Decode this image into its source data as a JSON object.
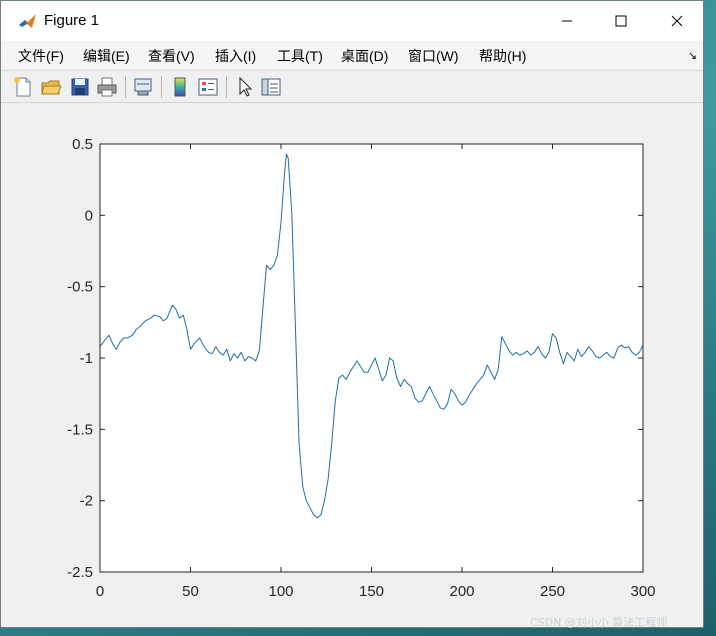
{
  "window": {
    "title": "Figure 1",
    "minimize_symbol": "—",
    "maximize_symbol": "☐",
    "close_symbol": "✕"
  },
  "menu": {
    "items": [
      "文件(F)",
      "编辑(E)",
      "查看(V)",
      "插入(I)",
      "工具(T)",
      "桌面(D)",
      "窗口(W)",
      "帮助(H)"
    ],
    "overflow_icon": "dock-arrow-icon"
  },
  "toolbar": {
    "buttons": [
      "new-figure-icon",
      "open-file-icon",
      "save-icon",
      "print-icon",
      "link-plot-icon",
      "insert-colorbar-icon",
      "insert-legend-icon",
      "edit-plot-icon",
      "property-inspector-icon"
    ]
  },
  "colors": {
    "line": "#1f6fa8",
    "axes_bg": "#ffffff",
    "figure_bg": "#f0f0f0"
  },
  "watermark": "CSDN @刘小小 算法工程师",
  "chart_data": {
    "type": "line",
    "title": "",
    "xlabel": "",
    "ylabel": "",
    "xlim": [
      0,
      300
    ],
    "ylim": [
      -2.5,
      0.5
    ],
    "xticks": [
      "0",
      "50",
      "100",
      "150",
      "200",
      "250",
      "300"
    ],
    "yticks": [
      "0.5",
      "0",
      "-0.5",
      "-1",
      "-1.5",
      "-2",
      "-2.5"
    ],
    "grid": false,
    "series": [
      {
        "name": "",
        "x": [
          0,
          3,
          5,
          7,
          9,
          11,
          13,
          15,
          18,
          20,
          22,
          25,
          28,
          30,
          33,
          35,
          37,
          39,
          40,
          42,
          44,
          46,
          48,
          50,
          52,
          55,
          58,
          60,
          62,
          64,
          66,
          68,
          70,
          72,
          74,
          76,
          78,
          80,
          82,
          84,
          86,
          88,
          90,
          92,
          94,
          96,
          98,
          100,
          102,
          103,
          104,
          106,
          108,
          110,
          112,
          114,
          116,
          118,
          120,
          122,
          124,
          126,
          128,
          130,
          132,
          134,
          136,
          138,
          140,
          142,
          144,
          146,
          148,
          150,
          152,
          154,
          156,
          158,
          160,
          162,
          164,
          166,
          168,
          170,
          172,
          174,
          176,
          178,
          180,
          182,
          184,
          186,
          188,
          190,
          192,
          194,
          196,
          198,
          200,
          202,
          204,
          206,
          208,
          210,
          212,
          214,
          216,
          218,
          220,
          222,
          224,
          226,
          228,
          230,
          232,
          234,
          236,
          238,
          240,
          242,
          244,
          246,
          248,
          250,
          252,
          254,
          256,
          258,
          260,
          262,
          264,
          266,
          268,
          270,
          272,
          274,
          276,
          278,
          280,
          282,
          284,
          286,
          288,
          290,
          292,
          294,
          296,
          298,
          300
        ],
        "y": [
          -0.92,
          -0.87,
          -0.84,
          -0.9,
          -0.94,
          -0.89,
          -0.86,
          -0.86,
          -0.84,
          -0.8,
          -0.78,
          -0.74,
          -0.72,
          -0.7,
          -0.71,
          -0.74,
          -0.72,
          -0.66,
          -0.63,
          -0.66,
          -0.72,
          -0.7,
          -0.8,
          -0.94,
          -0.9,
          -0.86,
          -0.93,
          -0.96,
          -0.97,
          -0.92,
          -0.96,
          -0.98,
          -0.94,
          -1.02,
          -0.97,
          -1.0,
          -0.96,
          -1.02,
          -0.99,
          -1.0,
          -1.02,
          -0.95,
          -0.65,
          -0.35,
          -0.38,
          -0.35,
          -0.28,
          -0.05,
          0.3,
          0.43,
          0.4,
          0.0,
          -0.8,
          -1.6,
          -1.9,
          -2.0,
          -2.05,
          -2.1,
          -2.12,
          -2.1,
          -2.0,
          -1.85,
          -1.6,
          -1.3,
          -1.14,
          -1.12,
          -1.15,
          -1.1,
          -1.06,
          -1.02,
          -1.06,
          -1.1,
          -1.1,
          -1.05,
          -1.0,
          -1.08,
          -1.16,
          -1.12,
          -1.0,
          -1.02,
          -1.14,
          -1.2,
          -1.15,
          -1.18,
          -1.2,
          -1.28,
          -1.31,
          -1.3,
          -1.25,
          -1.2,
          -1.25,
          -1.3,
          -1.35,
          -1.36,
          -1.32,
          -1.22,
          -1.25,
          -1.3,
          -1.33,
          -1.31,
          -1.26,
          -1.22,
          -1.18,
          -1.15,
          -1.12,
          -1.05,
          -1.1,
          -1.15,
          -1.08,
          -0.85,
          -0.9,
          -0.95,
          -0.98,
          -0.96,
          -0.98,
          -0.97,
          -0.95,
          -0.98,
          -0.96,
          -0.92,
          -0.97,
          -1.0,
          -0.96,
          -0.83,
          -0.86,
          -0.96,
          -1.04,
          -0.96,
          -0.99,
          -1.02,
          -0.94,
          -0.99,
          -0.96,
          -0.92,
          -0.95,
          -0.99,
          -1.0,
          -0.98,
          -0.96,
          -0.99,
          -1.0,
          -0.93,
          -0.91,
          -0.93,
          -0.92,
          -0.96,
          -0.98,
          -0.96,
          -0.91
        ]
      }
    ]
  }
}
